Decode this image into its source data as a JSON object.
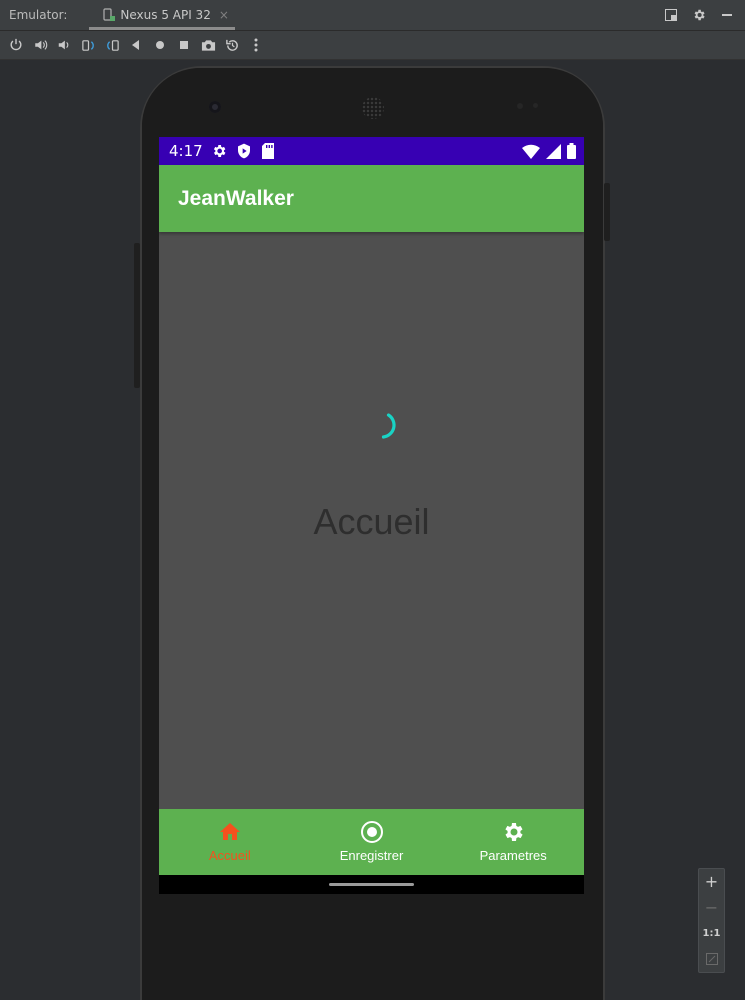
{
  "ide": {
    "panel_label": "Emulator:",
    "tab_label": "Nexus 5 API 32",
    "tab_close": "×"
  },
  "device": {
    "status_time": "4:17",
    "app_title": "JeanWalker",
    "home_text": "Accueil",
    "colors": {
      "status_bar": "#3700b3",
      "app_bar": "#5db150",
      "content_bg": "#4f4f4f",
      "active_nav": "#f4511e",
      "spinner": "#19d3c5"
    }
  },
  "bottom_nav": {
    "items": [
      {
        "label": "Accueil",
        "icon": "home-icon",
        "active": true
      },
      {
        "label": "Enregistrer",
        "icon": "record-icon",
        "active": false
      },
      {
        "label": "Parametres",
        "icon": "settings-icon",
        "active": false
      }
    ]
  },
  "zoom": {
    "zoom_in": "+",
    "zoom_out": "−",
    "actual_size": "1:1"
  }
}
